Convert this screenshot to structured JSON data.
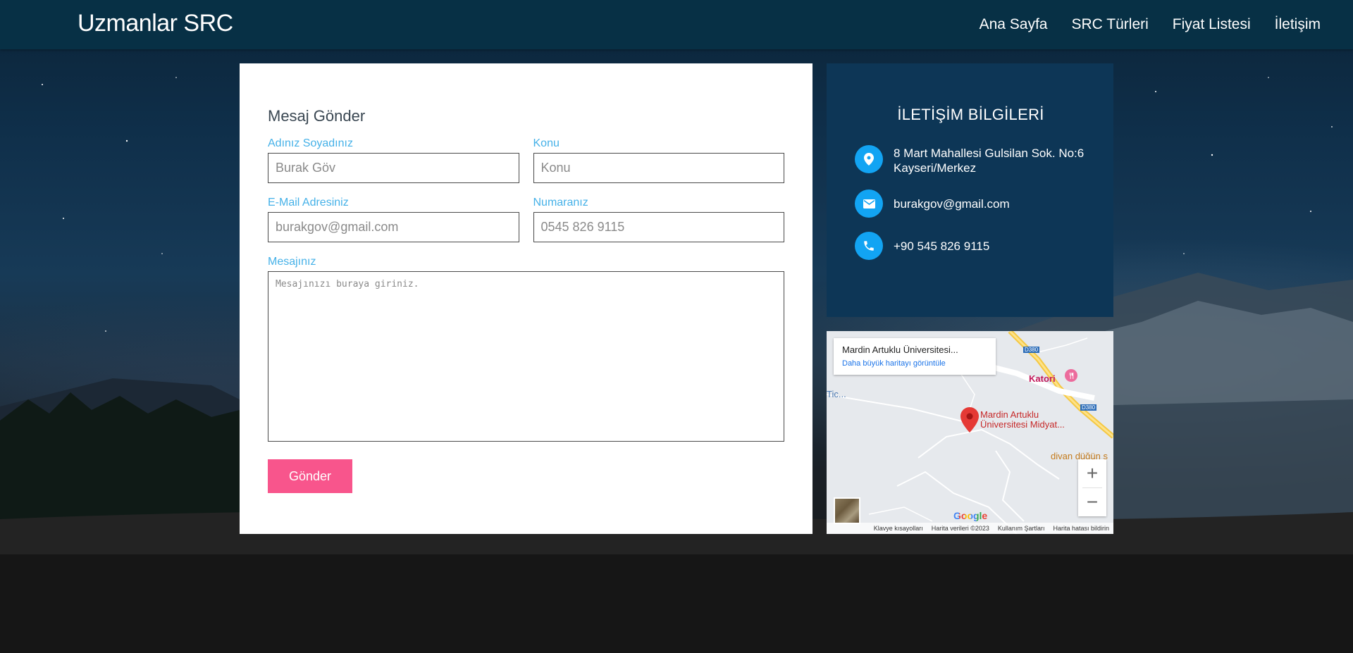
{
  "header": {
    "brand": "Uzmanlar SRC",
    "nav": [
      "Ana Sayfa",
      "SRC Türleri",
      "Fiyat Listesi",
      "İletişim"
    ]
  },
  "form": {
    "title": "Mesaj Gönder",
    "name_label": "Adınız Soyadınız",
    "name_placeholder": "Burak Göv",
    "subject_label": "Konu",
    "subject_placeholder": "Konu",
    "email_label": "E-Mail Adresiniz",
    "email_placeholder": "burakgov@gmail.com",
    "phone_label": "Numaranız",
    "phone_placeholder": "0545 826 9115",
    "message_label": "Mesajınız",
    "message_placeholder": "Mesajınızı buraya giriniz.",
    "submit_label": "Gönder"
  },
  "contact": {
    "title": "İLETİŞİM BİLGİLERİ",
    "address_line1": "8 Mart Mahallesi Gulsilan Sok. No:6",
    "address_line2": "Kayseri/Merkez",
    "email": "burakgov@gmail.com",
    "phone": "+90 545 826 9115"
  },
  "map": {
    "place_name": "Mardin Artuklu Üniversitesi...",
    "bigger_map_link": "Daha büyük haritayı görüntüle",
    "marker_label_line1": "Mardin Artuklu",
    "marker_label_line2": "Üniversitesi Midyat...",
    "poi_katori": "Katori",
    "poi_tic": "Tic...",
    "poi_divan": "divan düğün s",
    "road_shield": "D380",
    "zoom_in": "+",
    "zoom_out": "−",
    "logo": "Google",
    "footer": [
      "Klavye kısayolları",
      "Harita verileri ©2023",
      "Kullanım Şartları",
      "Harita hatası bildirin"
    ]
  },
  "colors": {
    "accent": "#45b1e8",
    "submit": "#f8558c",
    "header_bg": "#073045",
    "info_bg": "#0d3656",
    "icon_bg": "#12a4f3"
  }
}
